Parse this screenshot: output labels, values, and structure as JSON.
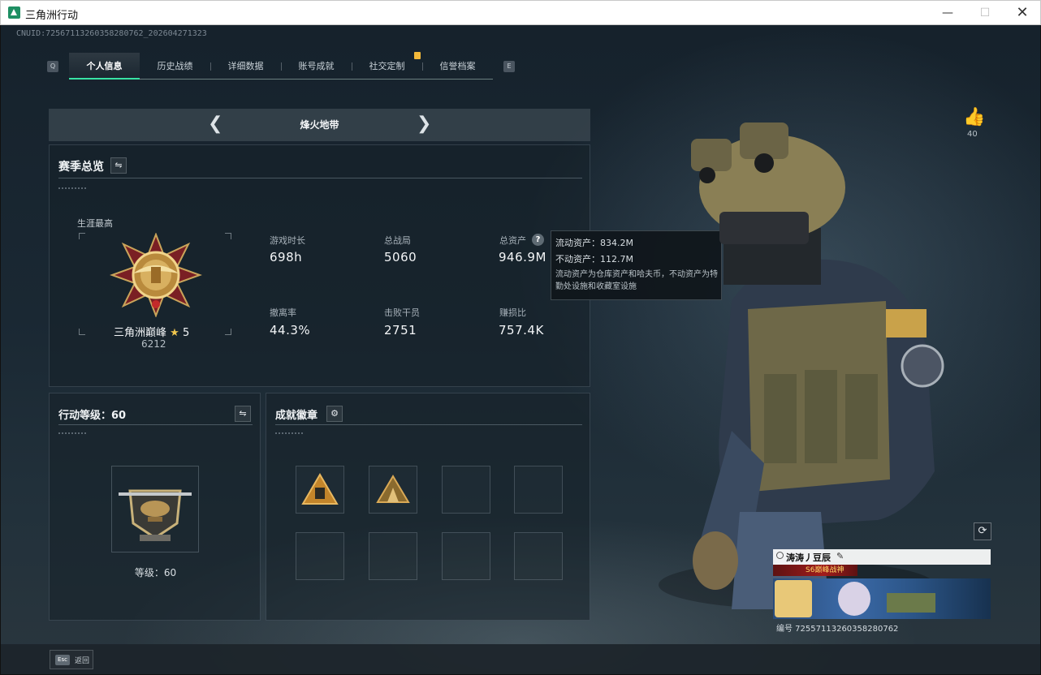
{
  "window": {
    "title": "三角洲行动",
    "minimize": "—",
    "maximize": "☐",
    "close": "✕"
  },
  "uid": "CNUID:7256711326035828076​2_202604271323",
  "tabs": {
    "prev_key": "Q",
    "next_key": "E",
    "items": [
      {
        "label": "个人信息",
        "active": true
      },
      {
        "label": "历史战绩",
        "active": false
      },
      {
        "label": "详细数据",
        "active": false
      },
      {
        "label": "账号成就",
        "active": false
      },
      {
        "label": "社交定制",
        "active": false
      },
      {
        "label": "信誉档案",
        "active": false
      }
    ]
  },
  "mode": {
    "title": "烽火地带",
    "prev": "❮",
    "next": "❯"
  },
  "season": {
    "title": "赛季总览",
    "swap_icon": "⇋",
    "career_best_label": "生涯最高",
    "rank_name": "三角洲巅峰",
    "rank_star": "★",
    "rank_level": "5",
    "rank_score": "6212",
    "stats": [
      {
        "label": "游戏时长",
        "value": "698h"
      },
      {
        "label": "总战局",
        "value": "5060"
      },
      {
        "label": "总资产",
        "value": "946.9M"
      },
      {
        "label": "撤离率",
        "value": "44.3%"
      },
      {
        "label": "击败干员",
        "value": "2751"
      },
      {
        "label": "赚损比",
        "value": "757.4K"
      }
    ],
    "help_icon": "?"
  },
  "tooltip": {
    "liquid": "流动资产：834.2M",
    "fixed": "不动资产：112.7M",
    "desc": "流动资产为仓库资产和哈夫币，不动资产为特勤处设施和收藏室设施"
  },
  "level": {
    "title": "行动等级：60",
    "swap_icon": "⇋",
    "caption": "等级：60"
  },
  "badges": {
    "title": "成就徽章",
    "settings_icon": "⚙"
  },
  "likes": {
    "count": "40",
    "icon": "👍"
  },
  "refresh_icon": "⟳",
  "namecard": {
    "name": "涛涛丿豆辰",
    "edit_icon": "✎",
    "title": "S6巅峰战神",
    "id": "编号 725571132603582807​62"
  },
  "bottom": {
    "esc_key": "Esc",
    "esc_label": "返回"
  }
}
